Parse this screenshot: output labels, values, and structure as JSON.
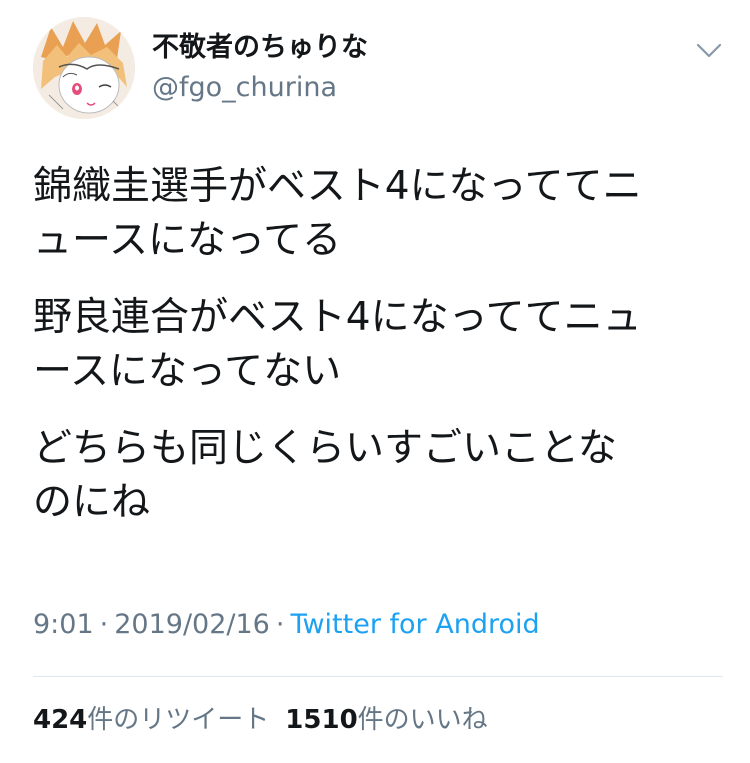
{
  "user": {
    "display_name": "不敬者のちゅりな",
    "handle": "@fgo_churina",
    "avatar_icon": "anime-girl-avatar"
  },
  "menu": {
    "icon": "chevron-down-icon"
  },
  "tweet": {
    "paragraphs": [
      "錦織圭選手がベスト4になっててニ\nュースになってる",
      "野良連合がベスト4になっててニュ\nースになってない",
      "どちらも同じくらいすごいことな\nのにね"
    ]
  },
  "meta": {
    "time": "9:01",
    "separator": "·",
    "date": "2019/02/16",
    "client": "Twitter for Android"
  },
  "stats": {
    "retweets_count": "424",
    "retweets_label": "件のリツイート",
    "likes_count": "1510",
    "likes_label": "件のいいね"
  },
  "colors": {
    "text": "#14171a",
    "secondary": "#657786",
    "link": "#1da1f2",
    "divider": "#e1e8ed"
  }
}
